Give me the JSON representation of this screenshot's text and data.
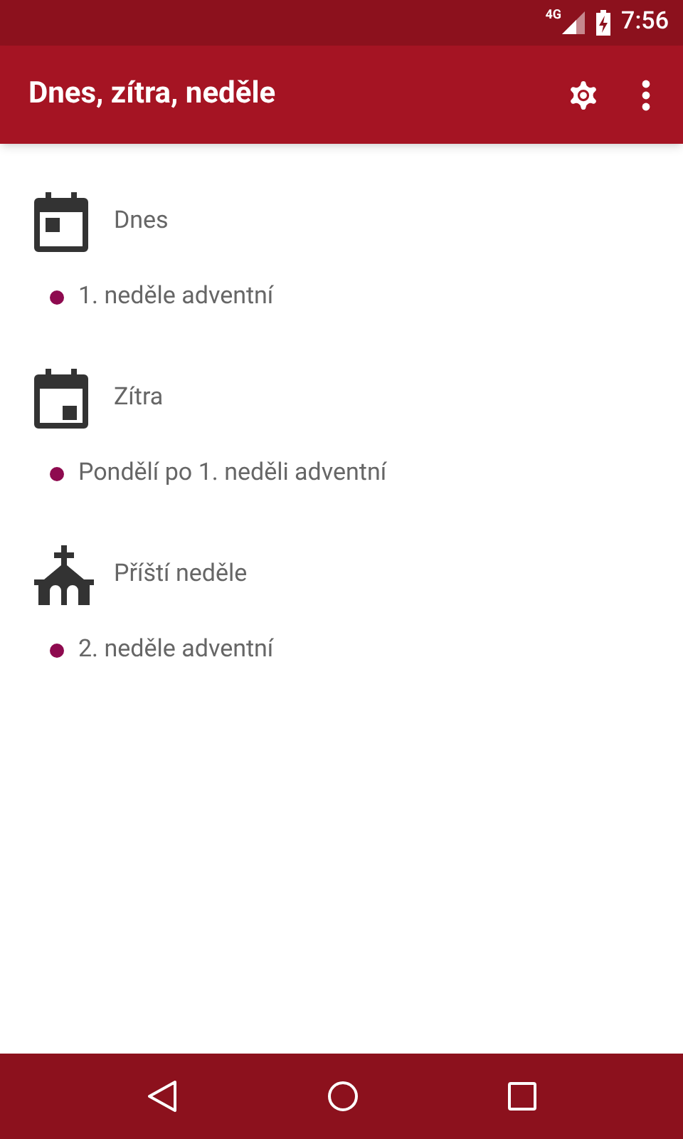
{
  "status_bar": {
    "network": "4G",
    "time": "7:56"
  },
  "app_bar": {
    "title": "Dnes, zítra, neděle"
  },
  "sections": [
    {
      "kind": "today",
      "title": "Dnes",
      "items": [
        {
          "text": "1. neděle adventní",
          "color": "#8e0a4f"
        }
      ]
    },
    {
      "kind": "tomorrow",
      "title": "Zítra",
      "items": [
        {
          "text": "Pondělí po 1. neděli adventní",
          "color": "#8e0a4f"
        }
      ]
    },
    {
      "kind": "sunday",
      "title": "Příští neděle",
      "items": [
        {
          "text": "2. neděle adventní",
          "color": "#8e0a4f"
        }
      ]
    }
  ]
}
